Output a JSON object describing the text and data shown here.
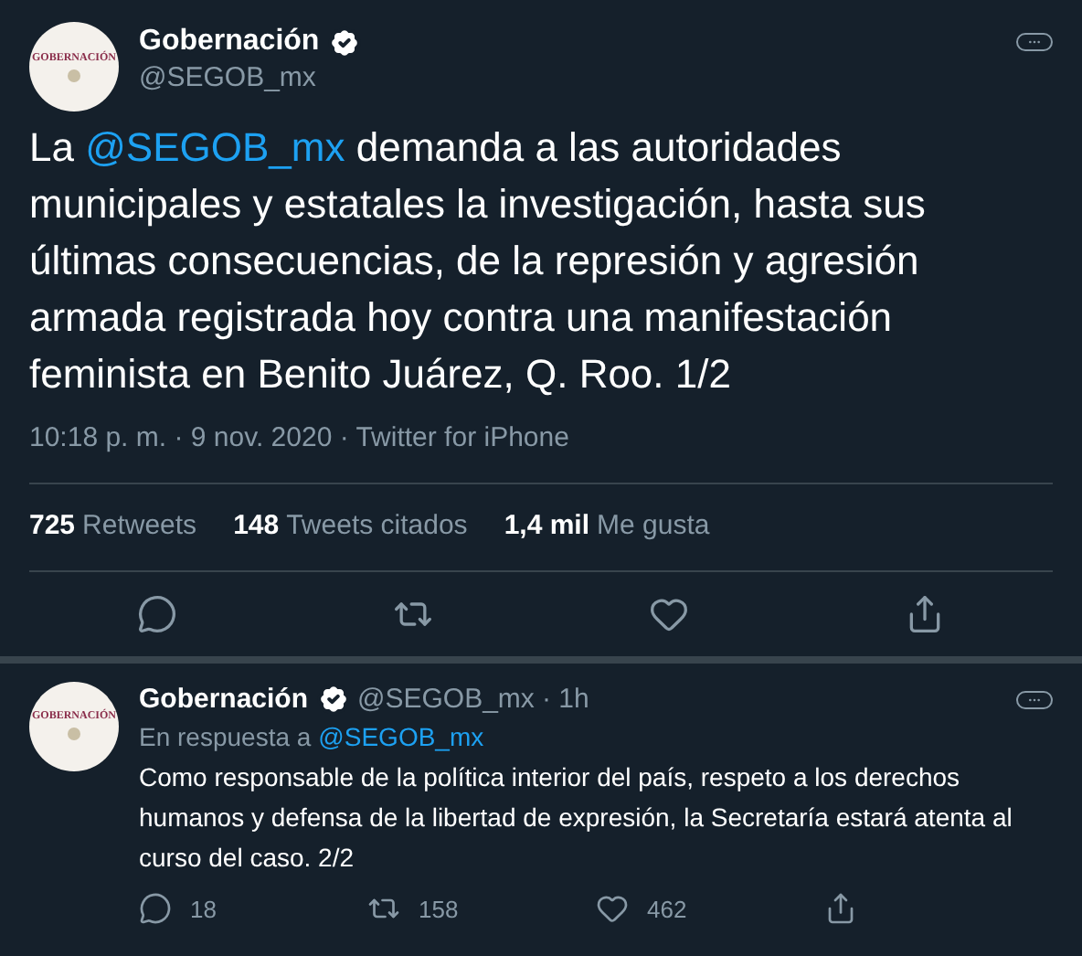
{
  "tweet": {
    "avatar_text": "GOBERNACIÓN",
    "name": "Gobernación",
    "handle": "@SEGOB_mx",
    "text_parts": [
      {
        "kind": "text",
        "text": "La "
      },
      {
        "kind": "mention",
        "text": "@SEGOB_mx"
      },
      {
        "kind": "text",
        "text": " demanda a las autoridades municipales y estatales la investigación, hasta sus últimas consecuencias, de la represión y agresión armada registrada hoy contra una manifestación feminista en Benito Juárez, Q. Roo. 1/2"
      }
    ],
    "meta": "10:18 p. m. · 9 nov. 2020 · Twitter for iPhone",
    "stats": [
      {
        "count": "725",
        "label": "Retweets"
      },
      {
        "count": "148",
        "label": "Tweets citados"
      },
      {
        "count": "1,4 mil",
        "label": "Me gusta"
      }
    ],
    "actions": [
      {
        "kind": "reply"
      },
      {
        "kind": "retweet"
      },
      {
        "kind": "like"
      },
      {
        "kind": "share"
      }
    ]
  },
  "reply": {
    "avatar_text": "GOBERNACIÓN",
    "name": "Gobernación",
    "handle": "@SEGOB_mx",
    "time": "· 1h",
    "reply_to_label": "En respuesta a",
    "reply_to": "@SEGOB_mx",
    "text": "Como responsable de la política interior del país, respeto a los derechos humanos y defensa de la libertad de expresión, la Secretaría estará atenta al curso del caso. 2/2",
    "actions": [
      {
        "kind": "reply",
        "count": "18"
      },
      {
        "kind": "retweet",
        "count": "158"
      },
      {
        "kind": "like",
        "count": "462"
      },
      {
        "kind": "share"
      }
    ]
  }
}
